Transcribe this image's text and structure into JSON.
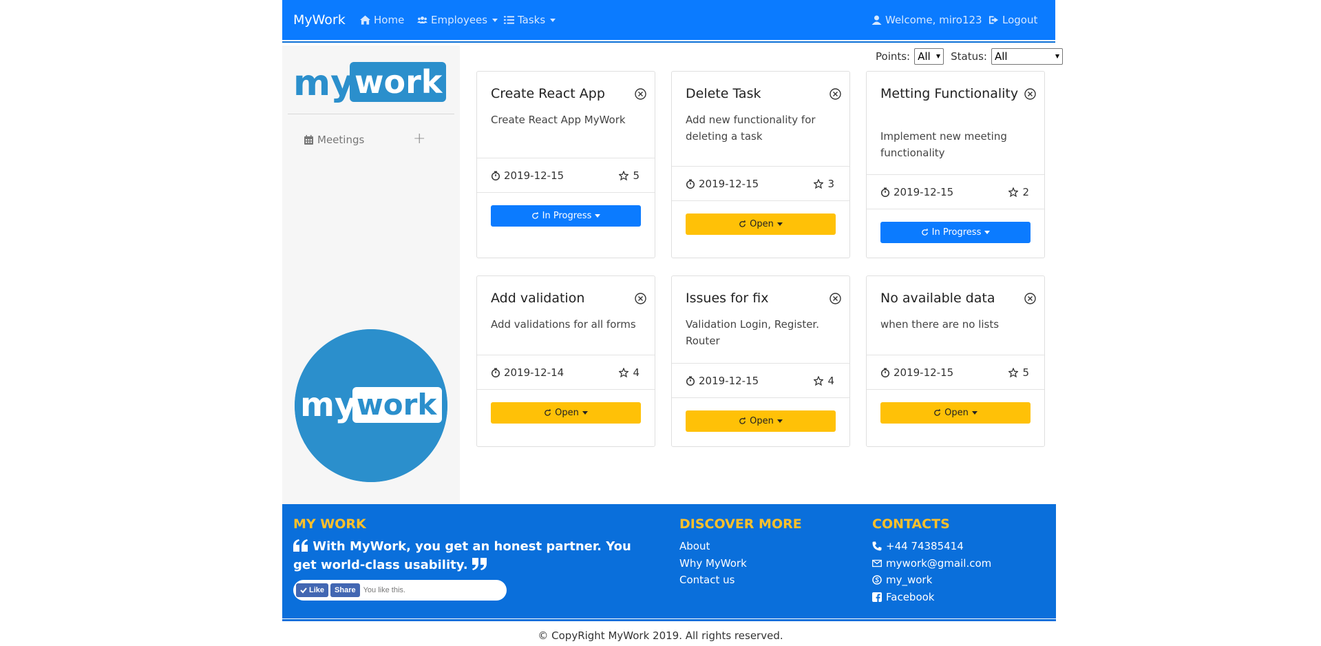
{
  "navbar": {
    "brand": "MyWork",
    "home": "Home",
    "employees": "Employees",
    "tasks": "Tasks",
    "welcome": "Welcome, miro123",
    "logout": "Logout",
    "color": "#0b7bff"
  },
  "sidebar": {
    "logo_text_left": "my",
    "logo_text_right": "work",
    "meetings": "Meetings",
    "add": "+"
  },
  "filters": {
    "points_label": "Points:",
    "points_value": "All",
    "status_label": "Status:",
    "status_value": "All"
  },
  "cards": [
    {
      "title": "Create React App",
      "desc": "Create React App MyWork",
      "date": "2019-12-15",
      "points": "5",
      "status": "In Progress"
    },
    {
      "title": "Delete Task",
      "desc": "Add new functionality for deleting a task",
      "date": "2019-12-15",
      "points": "3",
      "status": "Open"
    },
    {
      "title": "Metting Functionality",
      "desc": "Implement new meeting functionality",
      "date": "2019-12-15",
      "points": "2",
      "status": "In Progress"
    },
    {
      "title": "Add validation",
      "desc": "Add validations for all forms",
      "date": "2019-12-14",
      "points": "4",
      "status": "Open"
    },
    {
      "title": "Issues for fix",
      "desc": "Validation Login, Register. Router",
      "date": "2019-12-15",
      "points": "4",
      "status": "Open"
    },
    {
      "title": "No available data",
      "desc": "when there are no lists",
      "date": "2019-12-15",
      "points": "5",
      "status": "Open"
    }
  ],
  "footer": {
    "heading1": "MY WORK",
    "quote": "With MyWork, you get an honest partner. You get world-class usability.",
    "fb_like": "Like",
    "fb_share": "Share",
    "fb_text": "You like this.",
    "heading2": "DISCOVER MORE",
    "about": "About",
    "why": "Why MyWork",
    "contact": "Contact us",
    "heading3": "CONTACTS",
    "phone": "+44 74385414",
    "email": "mywork@gmail.com",
    "skype": "my_work",
    "facebook": "Facebook",
    "copyright": "© CopyRight MyWork 2019. All rights reserved."
  }
}
